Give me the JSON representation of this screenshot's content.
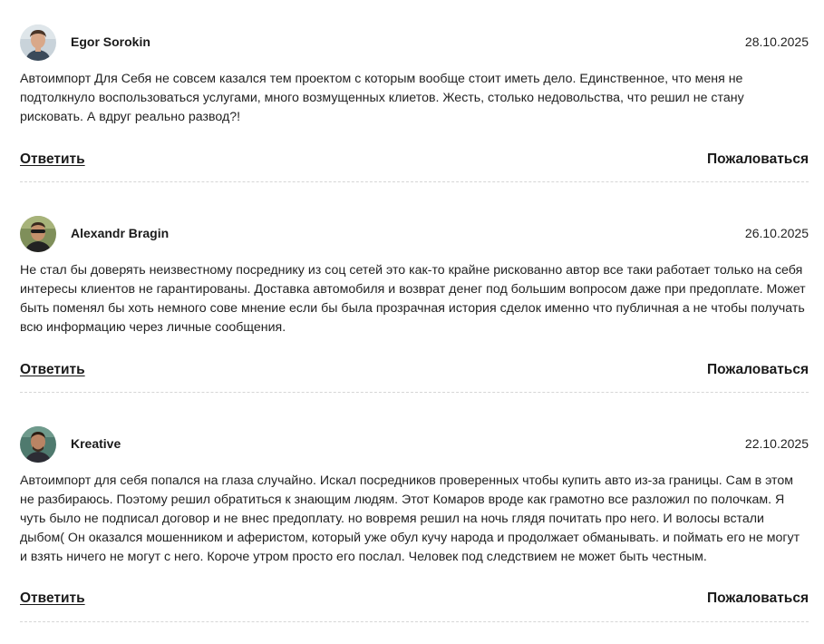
{
  "comments": [
    {
      "avatar_icon": "user-photo-icon",
      "author": "Egor Sorokin",
      "date": "28.10.2025",
      "text": "Автоимпорт Для Себя не совсем казался тем проектом с которым вообще стоит иметь дело. Единственное, что меня не подтолкнуло воспользоваться услугами, много возмущенных клиетов. Жесть, столько недовольства, что решил не стану рисковать. А вдруг реально развод?!",
      "reply_label": "Ответить",
      "report_label": "Пожаловаться"
    },
    {
      "avatar_icon": "user-photo-icon",
      "author": "Alexandr Bragin",
      "date": "26.10.2025",
      "text": "Не стал бы доверять неизвестному посреднику из соц сетей это как-то крайне рискованно автор все таки работает только на себя интересы клиентов не гарантированы. Доставка автомобиля и возврат денег под большим вопросом даже при предоплате. Может быть поменял бы хоть немного сове мнение если бы была прозрачная история сделок именно что публичная а не чтобы получать всю информацию через личные сообщения.",
      "reply_label": "Ответить",
      "report_label": "Пожаловаться"
    },
    {
      "avatar_icon": "user-photo-icon",
      "author": "Kreative",
      "date": "22.10.2025",
      "text": "Автоимпорт для себя попался на глаза случайно. Искал посредников проверенных чтобы купить авто из-за границы. Сам в этом не разбираюсь. Поэтому решил обратиться к знающим людям. Этот Комаров вроде как грамотно все разложил по полочкам. Я чуть было не подписал договор и не внес предоплату. но вовремя решил на ночь глядя почитать про него. И волосы встали дыбом( Он оказался мошенником и аферистом, который уже обул кучу народа и продолжает обманывать. и поймать его не могут и взять ничего не могут с него. Короче утром просто его послал. Человек под следствием не может быть честным.",
      "reply_label": "Ответить",
      "report_label": "Пожаловаться"
    }
  ]
}
